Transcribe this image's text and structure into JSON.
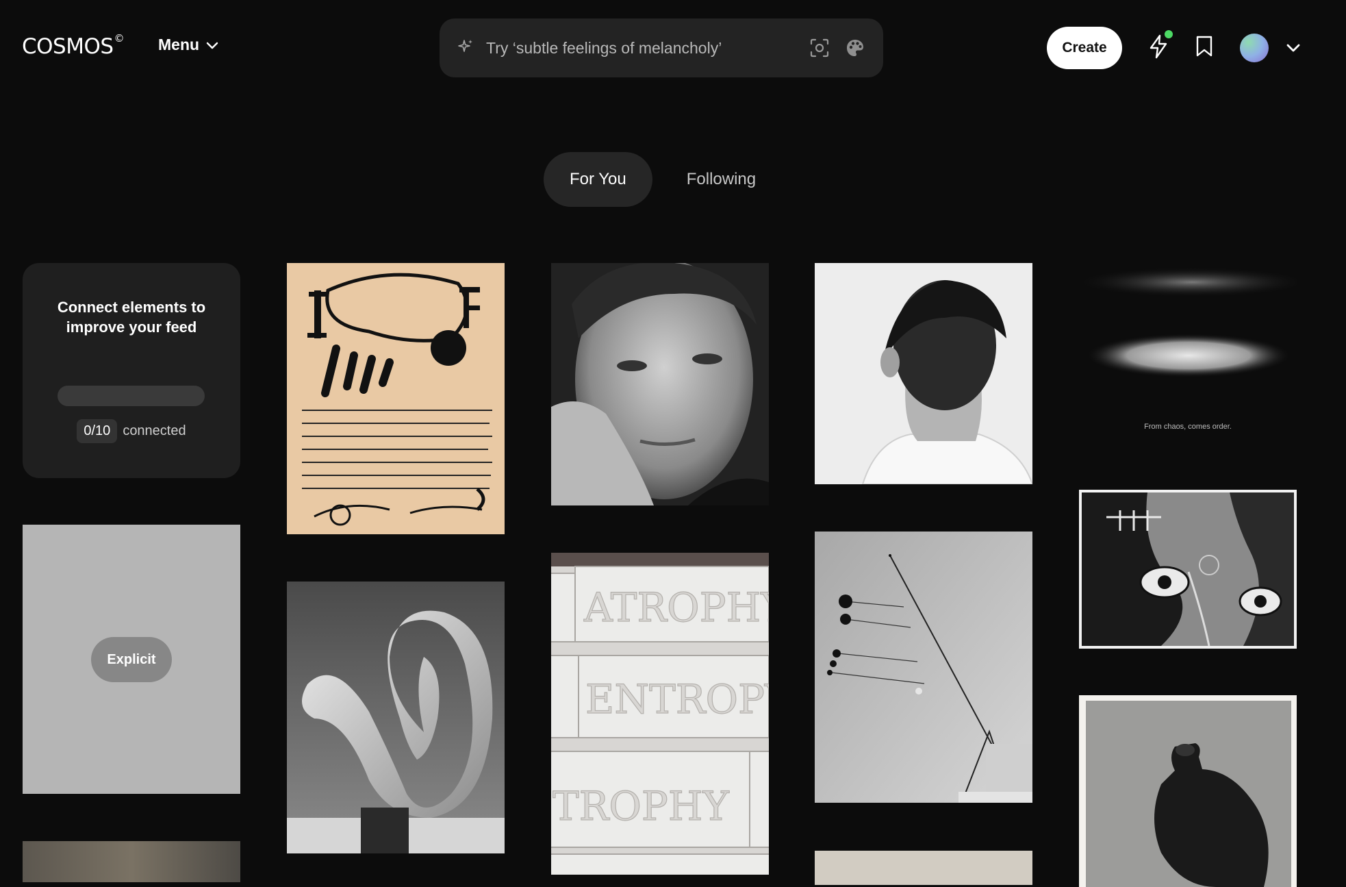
{
  "header": {
    "logo": "COSMOS",
    "logo_mark": "©",
    "menu_label": "Menu",
    "search_placeholder": "Try ‘subtle feelings of melancholy’",
    "create_label": "Create",
    "notification_dot": true
  },
  "tabs": [
    {
      "label": "For You",
      "active": true
    },
    {
      "label": "Following",
      "active": false
    }
  ],
  "connect_card": {
    "title": "Connect elements to improve your feed",
    "count": "0/10",
    "status": "connected",
    "progress": 0
  },
  "explicit_label": "Explicit",
  "tiles": [
    {
      "subject": "joan-miro-lete-print"
    },
    {
      "subject": "abstract-sculpture"
    },
    {
      "subject": "portrait-man-hand-on-cheek"
    },
    {
      "subject": "plaster-blocks-atrophy-entropy"
    },
    {
      "subject": "man-from-behind"
    },
    {
      "subject": "mobile-sculpture"
    },
    {
      "subject": "dark-light-streak",
      "caption": "From chaos, comes order."
    },
    {
      "subject": "sketch-faces"
    },
    {
      "subject": "dark-vase-sculpture"
    }
  ],
  "icons": {
    "search": "sparkle-icon",
    "camera": "visual-search-icon",
    "palette": "palette-icon",
    "activity": "bolt-icon",
    "saved": "bookmark-icon"
  }
}
